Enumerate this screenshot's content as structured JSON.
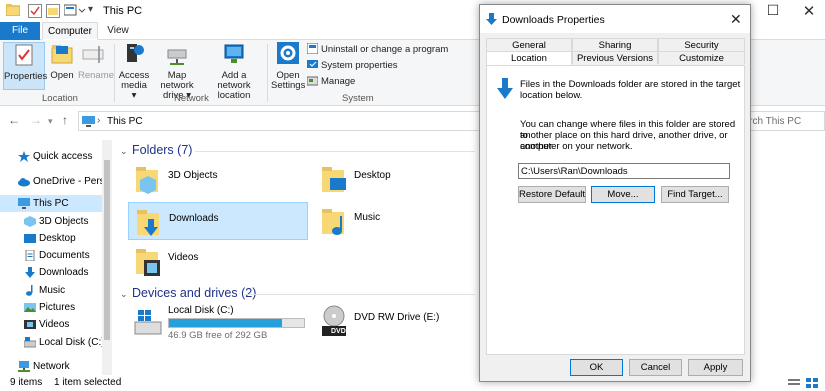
{
  "window": {
    "title": "This PC"
  },
  "ribbon": {
    "tabs": [
      "File",
      "Computer",
      "View"
    ],
    "location": {
      "label": "Location",
      "properties": "Properties",
      "open": "Open",
      "rename": "Rename"
    },
    "network": {
      "label": "Network",
      "access_media_1": "Access",
      "access_media_2": "media ▾",
      "map_drive_1": "Map network",
      "map_drive_2": "drive ▾",
      "add_location_1": "Add a network",
      "add_location_2": "location"
    },
    "system": {
      "label": "System",
      "open_settings_1": "Open",
      "open_settings_2": "Settings",
      "uninstall": "Uninstall or change a program",
      "system_properties": "System properties",
      "manage": "Manage"
    }
  },
  "address": {
    "path": "This PC",
    "search_placeholder": "earch This PC"
  },
  "navpane": {
    "items": [
      {
        "label": "Quick access",
        "icon": "star-icon"
      },
      {
        "label": "OneDrive - Persor",
        "icon": "cloud-icon"
      },
      {
        "label": "This PC",
        "icon": "computer-icon"
      },
      {
        "label": "3D Objects",
        "icon": "cube-icon"
      },
      {
        "label": "Desktop",
        "icon": "desktop-icon"
      },
      {
        "label": "Documents",
        "icon": "document-icon"
      },
      {
        "label": "Downloads",
        "icon": "download-icon"
      },
      {
        "label": "Music",
        "icon": "music-icon"
      },
      {
        "label": "Pictures",
        "icon": "picture-icon"
      },
      {
        "label": "Videos",
        "icon": "video-icon"
      },
      {
        "label": "Local Disk (C:)",
        "icon": "drive-icon"
      },
      {
        "label": "Network",
        "icon": "network-icon"
      }
    ]
  },
  "content": {
    "folders_heading": "Folders (7)",
    "folders": [
      {
        "name": "3D Objects"
      },
      {
        "name": "Desktop"
      },
      {
        "name": "Downloads"
      },
      {
        "name": "Music"
      },
      {
        "name": "Videos"
      }
    ],
    "devices_heading": "Devices and drives (2)",
    "drives": [
      {
        "name": "Local Disk (C:)",
        "free": "46.9 GB free of 292 GB",
        "used_fraction": 0.84
      },
      {
        "name": "DVD RW Drive (E:)",
        "badge": "DVD"
      }
    ]
  },
  "status": {
    "items": "9 items",
    "selected": "1 item selected"
  },
  "dialog": {
    "title": "Downloads Properties",
    "tabs_row1": [
      "General",
      "Sharing",
      "Security"
    ],
    "tabs_row2": [
      "Location",
      "Previous Versions",
      "Customize"
    ],
    "info_line1": "Files in the Downloads folder are stored in the target",
    "info_line2": "location below.",
    "move_line1": "You can change where files in this folder are stored to",
    "move_line2": "another place on this hard drive, another drive, or another",
    "move_line3": "computer on your network.",
    "path_value": "C:\\Users\\Ran\\Downloads",
    "restore_default": "Restore Default",
    "move": "Move...",
    "find_target": "Find Target...",
    "ok": "OK",
    "cancel": "Cancel",
    "apply": "Apply"
  },
  "colors": {
    "accent": "#1979ca",
    "selection": "#cce8ff",
    "folder": "#f8d775",
    "drive_fill": "#26a0da"
  }
}
